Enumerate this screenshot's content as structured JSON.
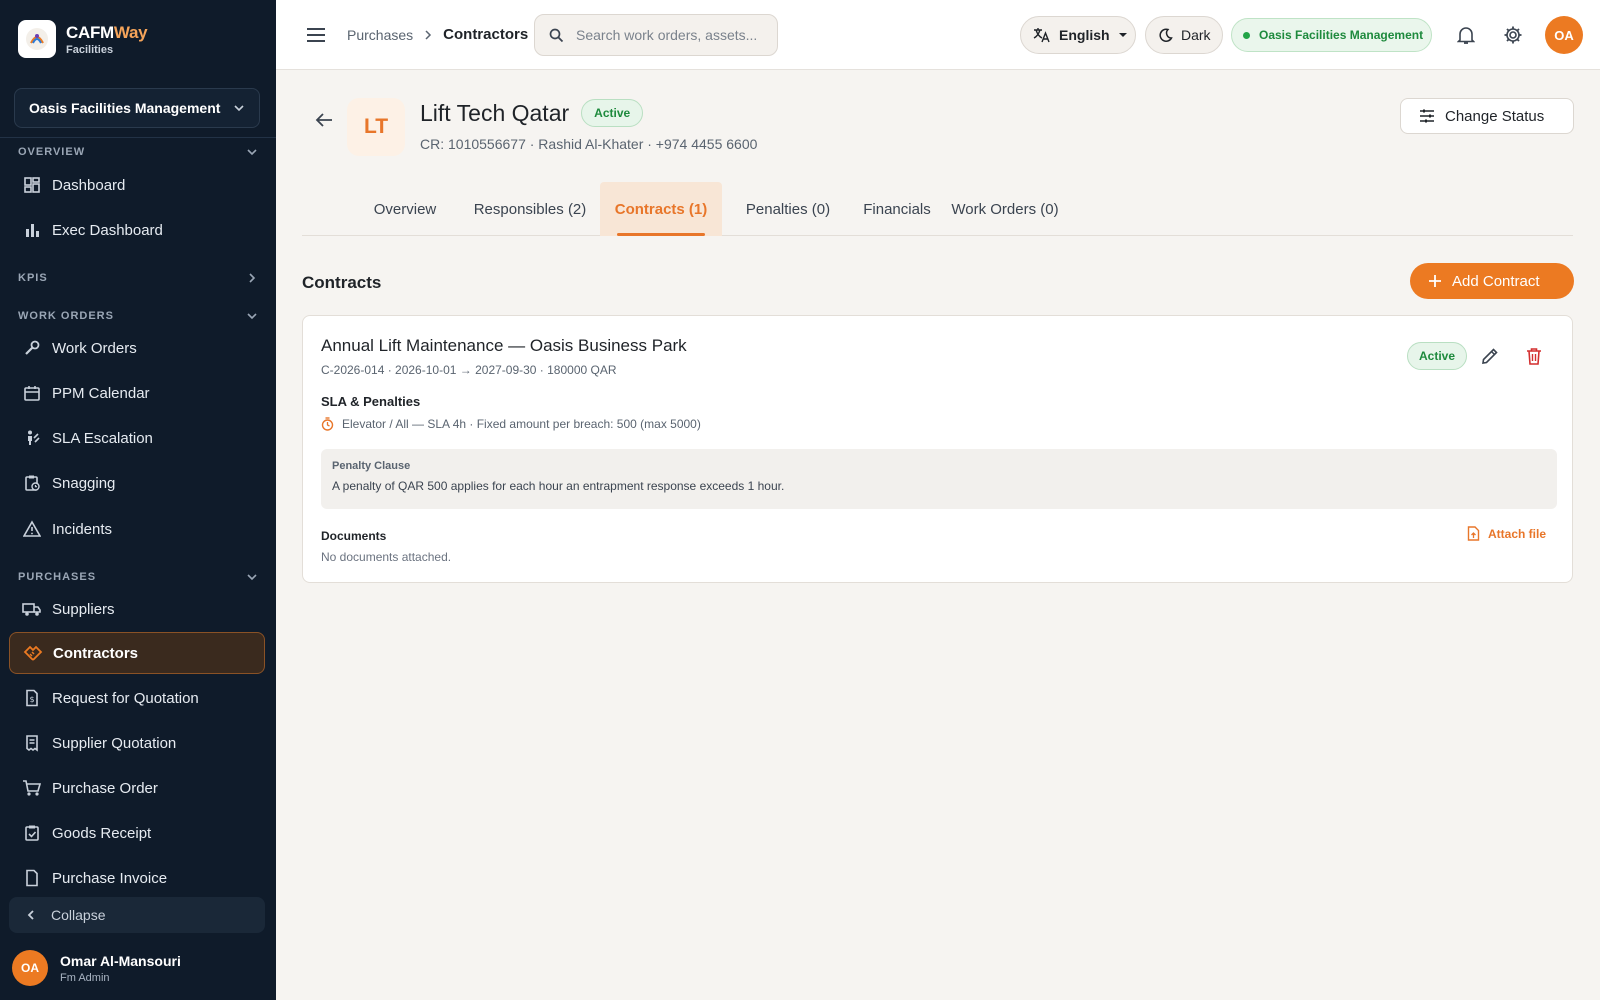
{
  "brand": {
    "name_main": "CAFM",
    "name_accent": "Way",
    "subtitle": "Facilities"
  },
  "sidebar": {
    "org_selector": "Oasis Facilities Management",
    "sections": [
      {
        "label": "OVERVIEW"
      },
      {
        "label": "KPIS"
      },
      {
        "label": "WORK ORDERS"
      },
      {
        "label": "PURCHASES"
      }
    ],
    "items": [
      {
        "label": "Dashboard"
      },
      {
        "label": "Exec Dashboard"
      },
      {
        "label": "Work Orders"
      },
      {
        "label": "PPM Calendar"
      },
      {
        "label": "SLA Escalation"
      },
      {
        "label": "Snagging"
      },
      {
        "label": "Incidents"
      },
      {
        "label": "Suppliers"
      },
      {
        "label": "Contractors"
      },
      {
        "label": "Request for Quotation"
      },
      {
        "label": "Supplier Quotation"
      },
      {
        "label": "Purchase Order"
      },
      {
        "label": "Goods Receipt"
      },
      {
        "label": "Purchase Invoice"
      }
    ],
    "collapse_label": "Collapse",
    "user": {
      "initials": "OA",
      "name": "Omar Al-Mansouri",
      "role": "Fm Admin"
    }
  },
  "topbar": {
    "breadcrumb": [
      "Purchases",
      "Contractors"
    ],
    "search_placeholder": "Search work orders, assets...",
    "language": "English",
    "theme_label": "Dark",
    "org_badge": "Oasis Facilities Management",
    "avatar_initials": "OA"
  },
  "entity": {
    "initials": "LT",
    "name": "Lift Tech Qatar",
    "status": "Active",
    "meta": "CR: 1010556677 · Rashid Al-Khater · +974 4455 6600",
    "change_status_label": "Change Status"
  },
  "tabs": [
    {
      "label": "Overview"
    },
    {
      "label": "Responsibles (2)"
    },
    {
      "label": "Contracts (1)"
    },
    {
      "label": "Penalties (0)"
    },
    {
      "label": "Financials"
    },
    {
      "label": "Work Orders (0)"
    }
  ],
  "contracts": {
    "section_title": "Contracts",
    "add_label": "Add Contract",
    "card": {
      "title": "Annual Lift Maintenance — Oasis Business Park",
      "subtitle": "C-2026-014 · 2026-10-01 → 2027-09-30 · 180000 QAR",
      "status": "Active",
      "sla_heading": "SLA & Penalties",
      "sla_line": "Elevator / All — SLA 4h · Fixed amount per breach: 500 (max 5000)",
      "clause_label": "Penalty Clause",
      "clause_text": "A penalty of QAR 500 applies for each hour an entrapment response exceeds 1 hour.",
      "documents_heading": "Documents",
      "documents_empty": "No documents attached.",
      "attach_label": "Attach file"
    }
  },
  "colors": {
    "accent": "#ec7a22",
    "sidebar_bg": "#0f1b2a",
    "success": "#1e8a3d",
    "danger": "#d32f2f"
  }
}
